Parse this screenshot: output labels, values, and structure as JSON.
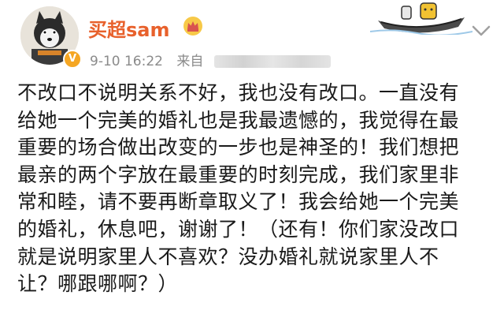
{
  "post": {
    "username": "买超sam",
    "timestamp": "9-10 16:22",
    "source_label": "来自",
    "body_lines": [
      "不改口不说明关系不好，我也没有改口。一直没有",
      "给她一个完美的婚礼也是我最遗憾的，我觉得在最",
      "重要的场合做出改变的一步也是神圣的！我们想把",
      "最亲的两个字放在最重要的时刻完成，我们家里非",
      "常和睦，请不要再断章取义了！我会给她一个完美",
      "的婚礼，休息吧，谢谢了！（还有！你们家没改口",
      "就是说明家里人不喜欢？没办婚礼就说家里人不",
      "让？哪跟哪啊？）"
    ],
    "verified_badge": "V",
    "icons": [
      "avatar",
      "crown-icon",
      "boat-sticker",
      "chevron-down-icon"
    ],
    "colors": {
      "username": "#e8612c",
      "meta": "#8a8a8a",
      "body": "#1a1a1a",
      "badge": "#f5a623"
    }
  }
}
